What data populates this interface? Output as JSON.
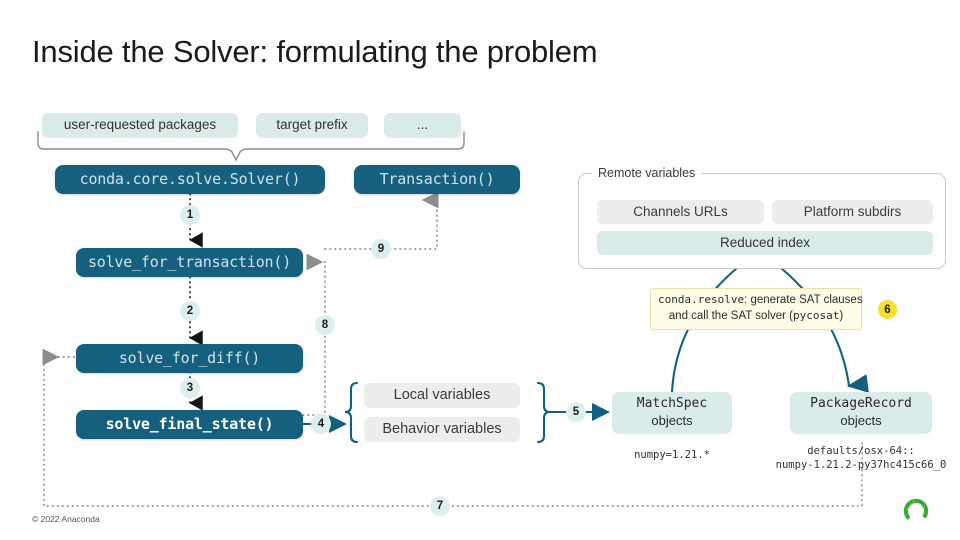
{
  "slide": {
    "title": "Inside the Solver: formulating the problem",
    "copyright": "© 2022 Anaconda",
    "logo_name": "anaconda-logo"
  },
  "colors": {
    "dark_teal": "#15607f",
    "light_teal": "#d9ecea",
    "badge_teal": "#dcefee",
    "badge_yellow": "#f7e02e",
    "gray_pill": "#ededed",
    "callout_bg": "#fffce8",
    "arrow_teal": "#11607f",
    "dotted_gray": "#9a9a9a",
    "logo_green": "#3aaa35"
  },
  "inputs": {
    "items": [
      {
        "label": "user-requested packages"
      },
      {
        "label": "target prefix"
      },
      {
        "label": "..."
      }
    ]
  },
  "flow_nodes": {
    "solver": "conda.core.solve.Solver()",
    "transaction": "Transaction()",
    "solve_for_transaction": "solve_for_transaction()",
    "solve_for_diff": "solve_for_diff()",
    "solve_final_state": "solve_final_state()"
  },
  "variables": {
    "local": "Local variables",
    "behavior": "Behavior variables"
  },
  "remote": {
    "legend": "Remote variables",
    "channels": "Channels URLs",
    "platform": "Platform subdirs",
    "reduced_index": "Reduced index"
  },
  "callout": {
    "line1_code": "conda.resolve",
    "line1_text": ": generate SAT clauses",
    "line2_text_a": "and call the SAT solver (",
    "line2_code": "pycosat",
    "line2_text_b": ")"
  },
  "objects": {
    "matchspec": {
      "title": "MatchSpec",
      "subtitle": "objects",
      "example": "numpy=1.21.*"
    },
    "packagerecord": {
      "title": "PackageRecord",
      "subtitle": "objects",
      "example": "defaults/osx-64::\nnumpy-1.21.2-py37hc415c66_0"
    }
  },
  "steps": [
    {
      "n": "1"
    },
    {
      "n": "2"
    },
    {
      "n": "3"
    },
    {
      "n": "4"
    },
    {
      "n": "5"
    },
    {
      "n": "6"
    },
    {
      "n": "7"
    },
    {
      "n": "8"
    },
    {
      "n": "9"
    }
  ]
}
